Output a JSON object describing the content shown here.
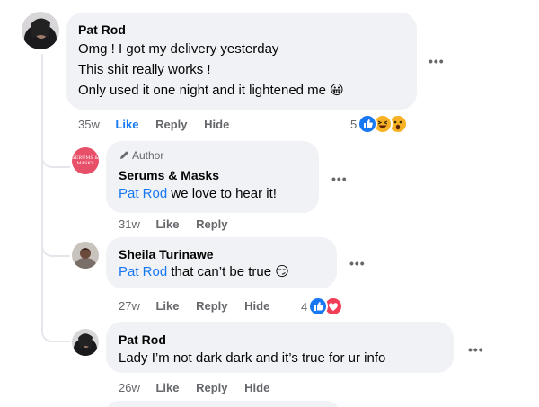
{
  "comments": [
    {
      "author": "Pat Rod",
      "lines": [
        "Omg ! I got my delivery yesterday",
        "This shit really works !",
        "Only used it one night and it lightened me 😀"
      ],
      "time": "35w",
      "like": "Like",
      "reply": "Reply",
      "hide": "Hide",
      "reaction_count": "5",
      "reactions": [
        "like-icon",
        "haha-icon",
        "wow-icon"
      ]
    },
    {
      "author": "Serums & Masks",
      "author_badge": "Author",
      "avatar_text": "SERUMS & MASKS",
      "mention": "Pat Rod",
      "text": " we love to hear it!",
      "time": "31w",
      "like": "Like",
      "reply": "Reply"
    },
    {
      "author": "Sheila Turinawe",
      "mention": "Pat Rod",
      "text": " that can’t be true 😏",
      "time": "27w",
      "like": "Like",
      "reply": "Reply",
      "hide": "Hide",
      "reaction_count": "4",
      "reactions": [
        "like-icon",
        "love-icon"
      ]
    },
    {
      "author": "Pat Rod",
      "text": "Lady I’m not dark dark and it’s true for ur info",
      "time": "26w",
      "like": "Like",
      "reply": "Reply",
      "hide": "Hide"
    }
  ],
  "more_label": "•••",
  "colors": {
    "link": "#1877f2",
    "bubble": "#f0f2f5",
    "meta": "#65676b",
    "brand_avatar": "#e8506a"
  }
}
